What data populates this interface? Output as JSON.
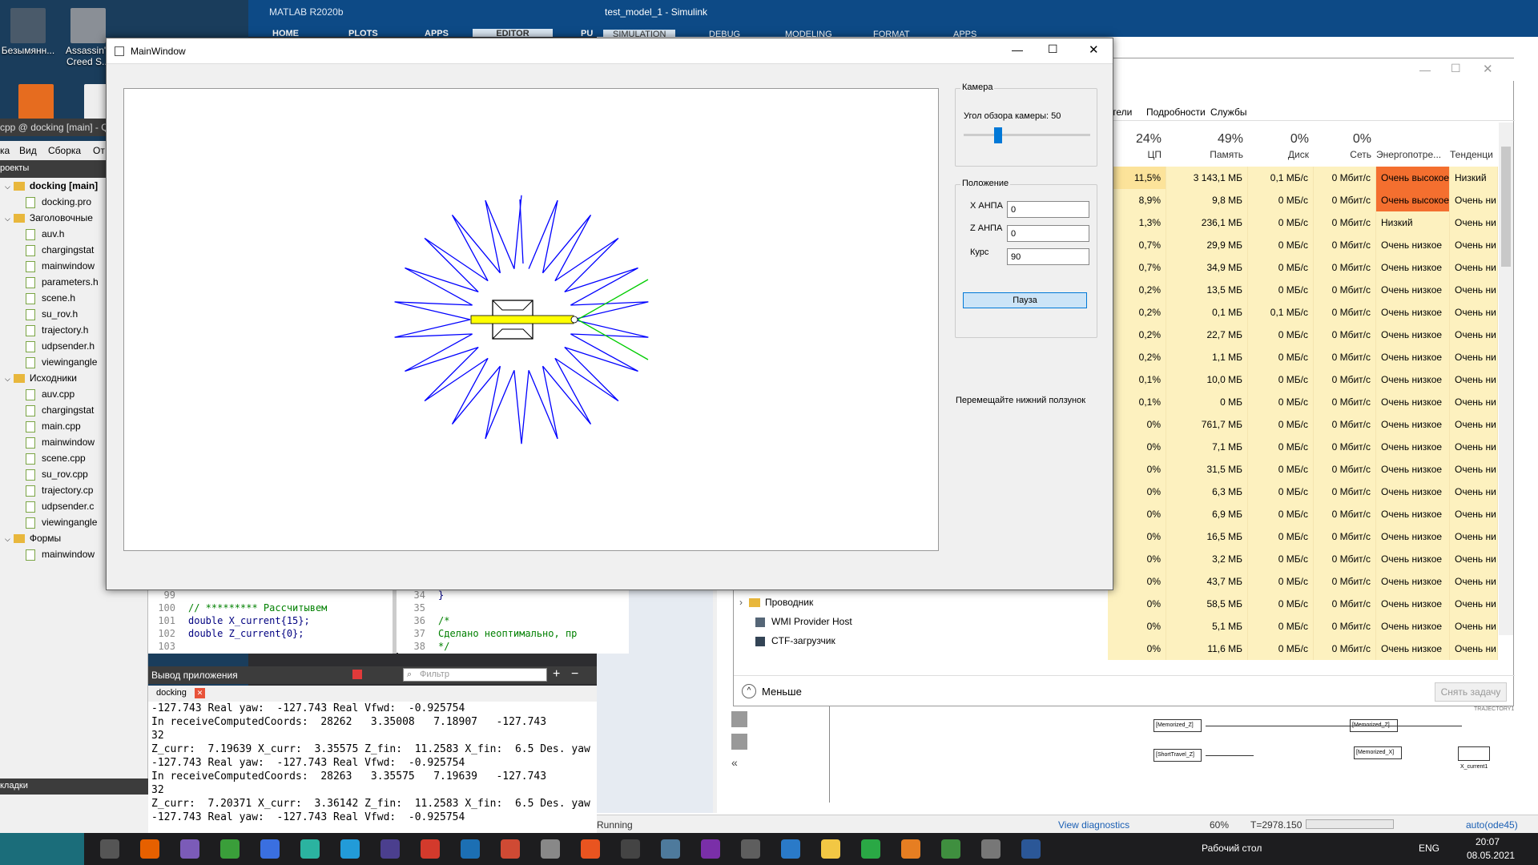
{
  "desktop": {
    "icons": [
      {
        "label": "Безымянн..."
      },
      {
        "label": "Assassin's Creed S..."
      }
    ]
  },
  "matlab": {
    "title": "MATLAB R2020b",
    "tabs": [
      "HOME",
      "PLOTS",
      "APPS",
      "EDITOR",
      "PU"
    ]
  },
  "simulink": {
    "title": "test_model_1 - Simulink",
    "tabs": [
      "SIMULATION",
      "DEBUG",
      "MODELING",
      "FORMAT",
      "APPS"
    ],
    "status": "Running",
    "view_diagnostics": "View diagnostics",
    "zoom": "60%",
    "time": "T=2978.150",
    "solver": "auto(ode45)",
    "blocks": [
      "[Memorized_Z]",
      "[ShortTravel_Z]",
      "[Memorized_Z]",
      "[Memorized_X]",
      "X_current1",
      "TRAJECTORY1"
    ]
  },
  "qt": {
    "title": "cpp @ docking [main] - Qt",
    "menu": [
      "ка",
      "Вид",
      "Сборка",
      "От"
    ],
    "projects_label": "роекты",
    "tree": [
      {
        "label": "docking [main]",
        "kind": "project",
        "indent": 0
      },
      {
        "label": "docking.pro",
        "kind": "file",
        "indent": 1
      },
      {
        "label": "Заголовочные",
        "kind": "folder",
        "indent": 0
      },
      {
        "label": "auv.h",
        "kind": "file",
        "indent": 1
      },
      {
        "label": "chargingstat",
        "kind": "file",
        "indent": 1
      },
      {
        "label": "mainwindow",
        "kind": "file",
        "indent": 1
      },
      {
        "label": "parameters.h",
        "kind": "file",
        "indent": 1
      },
      {
        "label": "scene.h",
        "kind": "file",
        "indent": 1
      },
      {
        "label": "su_rov.h",
        "kind": "file",
        "indent": 1
      },
      {
        "label": "trajectory.h",
        "kind": "file",
        "indent": 1
      },
      {
        "label": "udpsender.h",
        "kind": "file",
        "indent": 1
      },
      {
        "label": "viewingangle",
        "kind": "file",
        "indent": 1
      },
      {
        "label": "Исходники",
        "kind": "folder",
        "indent": 0
      },
      {
        "label": "auv.cpp",
        "kind": "file",
        "indent": 1
      },
      {
        "label": "chargingstat",
        "kind": "file",
        "indent": 1
      },
      {
        "label": "main.cpp",
        "kind": "file",
        "indent": 1
      },
      {
        "label": "mainwindow",
        "kind": "file",
        "indent": 1
      },
      {
        "label": "scene.cpp",
        "kind": "file",
        "indent": 1
      },
      {
        "label": "su_rov.cpp",
        "kind": "file",
        "indent": 1
      },
      {
        "label": "trajectory.cp",
        "kind": "file",
        "indent": 1
      },
      {
        "label": "udpsender.c",
        "kind": "file",
        "indent": 1
      },
      {
        "label": "viewingangle",
        "kind": "file",
        "indent": 1
      },
      {
        "label": "Формы",
        "kind": "folder",
        "indent": 0
      },
      {
        "label": "mainwindow",
        "kind": "file",
        "indent": 1
      }
    ],
    "bookmarks_label": "кладки",
    "code_lines": [
      {
        "num": "99",
        "text": ""
      },
      {
        "num": "100",
        "text": "// ********* Рассчитывем"
      },
      {
        "num": "101",
        "text": "double X_current{15};"
      },
      {
        "num": "102",
        "text": "double Z_current{0};"
      },
      {
        "num": "103",
        "text": ""
      }
    ],
    "code_lines2": [
      {
        "num": "34",
        "text": "}"
      },
      {
        "num": "35",
        "text": ""
      },
      {
        "num": "36",
        "text": "/*"
      },
      {
        "num": "37",
        "text": "Сделано неоптимально, пр"
      },
      {
        "num": "38",
        "text": "*/"
      }
    ],
    "output_title": "Вывод приложения",
    "filter_placeholder": "Фильтр",
    "output_tab": "docking",
    "output_lines": [
      "-127.743 Real yaw:  -127.743 Real Vfwd:  -0.925754",
      "In receiveComputedCoords:  28262   3.35008   7.18907   -127.743",
      "32",
      "Z_curr:  7.19639 X_curr:  3.35575 Z_fin:  11.2583 X_fin:  6.5 Des. yaw",
      "-127.743 Real yaw:  -127.743 Real Vfwd:  -0.925754",
      "In receiveComputedCoords:  28263   3.35575   7.19639   -127.743",
      "32",
      "Z_curr:  7.20371 X_curr:  3.36142 Z_fin:  11.2583 X_fin:  6.5 Des. yaw",
      "-127.743 Real yaw:  -127.743 Real Vfwd:  -0.925754"
    ]
  },
  "taskmgr": {
    "tabs": [
      "тели",
      "Подробности",
      "Службы"
    ],
    "columns": [
      {
        "pct": "24%",
        "label": "ЦП"
      },
      {
        "pct": "49%",
        "label": "Память"
      },
      {
        "pct": "0%",
        "label": "Диск"
      },
      {
        "pct": "0%",
        "label": "Сеть"
      },
      {
        "pct": "",
        "label": "Энергопотре..."
      },
      {
        "pct": "",
        "label": "Тенденция э"
      }
    ],
    "rows": [
      [
        "11,5%",
        "3 143,1 МБ",
        "0,1 МБ/с",
        "0 Мбит/с",
        "Очень высокое",
        "Низкий"
      ],
      [
        "8,9%",
        "9,8 МБ",
        "0 МБ/с",
        "0 Мбит/с",
        "Очень высокое",
        "Очень ни"
      ],
      [
        "1,3%",
        "236,1 МБ",
        "0 МБ/с",
        "0 Мбит/с",
        "Низкий",
        "Очень ни"
      ],
      [
        "0,7%",
        "29,9 МБ",
        "0 МБ/с",
        "0 Мбит/с",
        "Очень низкое",
        "Очень ни"
      ],
      [
        "0,7%",
        "34,9 МБ",
        "0 МБ/с",
        "0 Мбит/с",
        "Очень низкое",
        "Очень ни"
      ],
      [
        "0,2%",
        "13,5 МБ",
        "0 МБ/с",
        "0 Мбит/с",
        "Очень низкое",
        "Очень ни"
      ],
      [
        "0,2%",
        "0,1 МБ",
        "0,1 МБ/с",
        "0 Мбит/с",
        "Очень низкое",
        "Очень ни"
      ],
      [
        "0,2%",
        "22,7 МБ",
        "0 МБ/с",
        "0 Мбит/с",
        "Очень низкое",
        "Очень ни"
      ],
      [
        "0,2%",
        "1,1 МБ",
        "0 МБ/с",
        "0 Мбит/с",
        "Очень низкое",
        "Очень ни"
      ],
      [
        "0,1%",
        "10,0 МБ",
        "0 МБ/с",
        "0 Мбит/с",
        "Очень низкое",
        "Очень ни"
      ],
      [
        "0,1%",
        "0 МБ",
        "0 МБ/с",
        "0 Мбит/с",
        "Очень низкое",
        "Очень ни"
      ],
      [
        "0%",
        "761,7 МБ",
        "0 МБ/с",
        "0 Мбит/с",
        "Очень низкое",
        "Очень ни"
      ],
      [
        "0%",
        "7,1 МБ",
        "0 МБ/с",
        "0 Мбит/с",
        "Очень низкое",
        "Очень ни"
      ],
      [
        "0%",
        "31,5 МБ",
        "0 МБ/с",
        "0 Мбит/с",
        "Очень низкое",
        "Очень ни"
      ],
      [
        "0%",
        "6,3 МБ",
        "0 МБ/с",
        "0 Мбит/с",
        "Очень низкое",
        "Очень ни"
      ],
      [
        "0%",
        "6,9 МБ",
        "0 МБ/с",
        "0 Мбит/с",
        "Очень низкое",
        "Очень ни"
      ],
      [
        "0%",
        "16,5 МБ",
        "0 МБ/с",
        "0 Мбит/с",
        "Очень низкое",
        "Очень ни"
      ],
      [
        "0%",
        "3,2 МБ",
        "0 МБ/с",
        "0 Мбит/с",
        "Очень низкое",
        "Очень ни"
      ],
      [
        "0%",
        "43,7 МБ",
        "0 МБ/с",
        "0 Мбит/с",
        "Очень низкое",
        "Очень ни"
      ],
      [
        "0%",
        "58,5 МБ",
        "0 МБ/с",
        "0 Мбит/с",
        "Очень низкое",
        "Очень ни"
      ],
      [
        "0%",
        "5,1 МБ",
        "0 МБ/с",
        "0 Мбит/с",
        "Очень низкое",
        "Очень ни"
      ],
      [
        "0%",
        "11,6 МБ",
        "0 МБ/с",
        "0 Мбит/с",
        "Очень низкое",
        "Очень ни"
      ]
    ],
    "processes": [
      "Проводник",
      "WMI Provider Host",
      "CTF-загрузчик"
    ],
    "less_label": "Меньше",
    "end_task": "Снять задачу",
    "colors": {
      "very_high": "#f46f2f",
      "low": "#fbe8a2",
      "cell": "#fdf1bf"
    }
  },
  "mainwindow": {
    "title": "MainWindow",
    "camera_group": "Камера",
    "angle_label": "Угол обзора камеры: 50",
    "angle_value": 50,
    "angle_fraction": 0.27,
    "position_group": "Положение",
    "x_label": "X АНПА",
    "x_value": "0",
    "z_label": "Z АНПА",
    "z_value": "0",
    "course_label": "Курс",
    "course_value": "90",
    "pause_label": "Пауза",
    "hint": "Перемещайте нижний ползунок",
    "colors": {
      "star": "#0000ff",
      "ray": "#00cc00",
      "rov": "#ffff00"
    }
  },
  "taskbar": {
    "desktop_label": "Рабочий стол",
    "lang": "ENG",
    "time": "20:07",
    "date": "08.05.2021"
  }
}
